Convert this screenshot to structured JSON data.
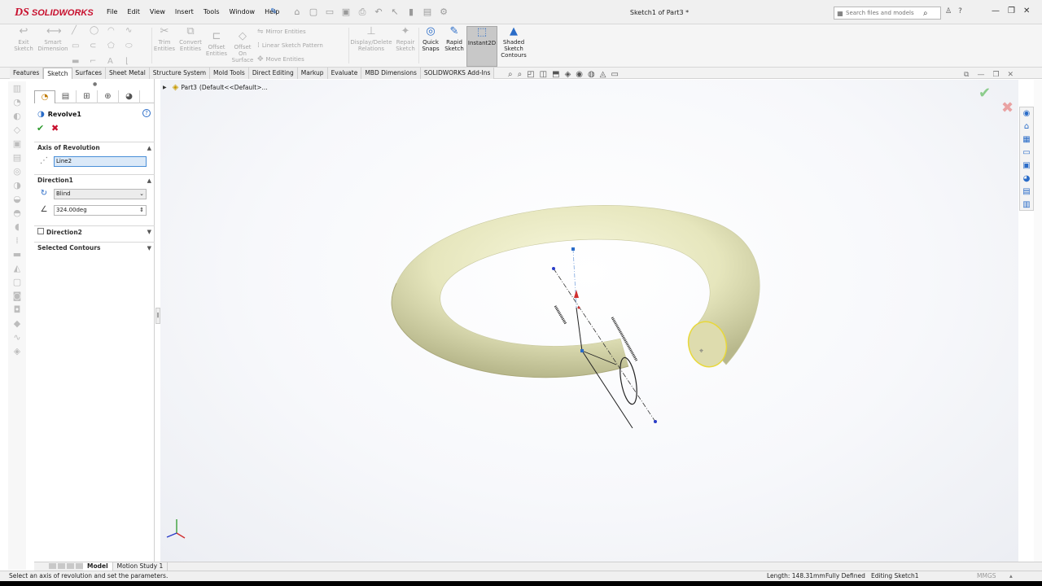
{
  "app": {
    "brand_ds": "DS",
    "brand_name": "SOLIDWORKS",
    "document_title": "Sketch1 of Part3 *",
    "menu": [
      "File",
      "Edit",
      "View",
      "Insert",
      "Tools",
      "Window",
      "Help"
    ],
    "search_placeholder": "Search files and models"
  },
  "ribbon": {
    "exit_sketch": "Exit Sketch",
    "smart_dimension": "Smart Dimension",
    "trim_entities": "Trim Entities",
    "convert_entities": "Convert Entities",
    "offset_entities": "Offset Entities",
    "offset_on_surface": "Offset On Surface",
    "mirror_entities": "Mirror Entities",
    "linear_sketch_pattern": "Linear Sketch Pattern",
    "move_entities": "Move Entities",
    "display_delete_relations": "Display/Delete Relations",
    "repair_sketch": "Repair Sketch",
    "quick_snaps": "Quick Snaps",
    "rapid_sketch": "Rapid Sketch",
    "instant2d": "Instant2D",
    "shaded_sketch_contours": "Shaded Sketch Contours"
  },
  "tabs": [
    "Features",
    "Sketch",
    "Surfaces",
    "Sheet Metal",
    "Structure System",
    "Mold Tools",
    "Direct Editing",
    "Markup",
    "Evaluate",
    "MBD Dimensions",
    "SOLIDWORKS Add-Ins"
  ],
  "active_tab": "Sketch",
  "property_manager": {
    "feature_title": "Revolve1",
    "axis_group": "Axis of Revolution",
    "axis_value": "Line2",
    "direction1_group": "Direction1",
    "end_condition": "Blind",
    "angle": "324.00deg",
    "direction2_group": "Direction2",
    "selected_contours_group": "Selected Contours"
  },
  "tree": {
    "part_label": "Part3",
    "config_label": "(Default<<Default>..."
  },
  "bottom_tabs": [
    "Model",
    "Motion Study 1"
  ],
  "status": {
    "message": "Select an axis of revolution and set the parameters.",
    "length": "Length: 148.31mm",
    "definition": "Fully Defined",
    "editing": "Editing Sketch1",
    "units": "MMGS"
  },
  "colors": {
    "brand_red": "#c8102e",
    "accent_blue": "#2a6cc8",
    "torus_fill": "#e6e6bd",
    "ok_green": "#2e9b2e"
  }
}
